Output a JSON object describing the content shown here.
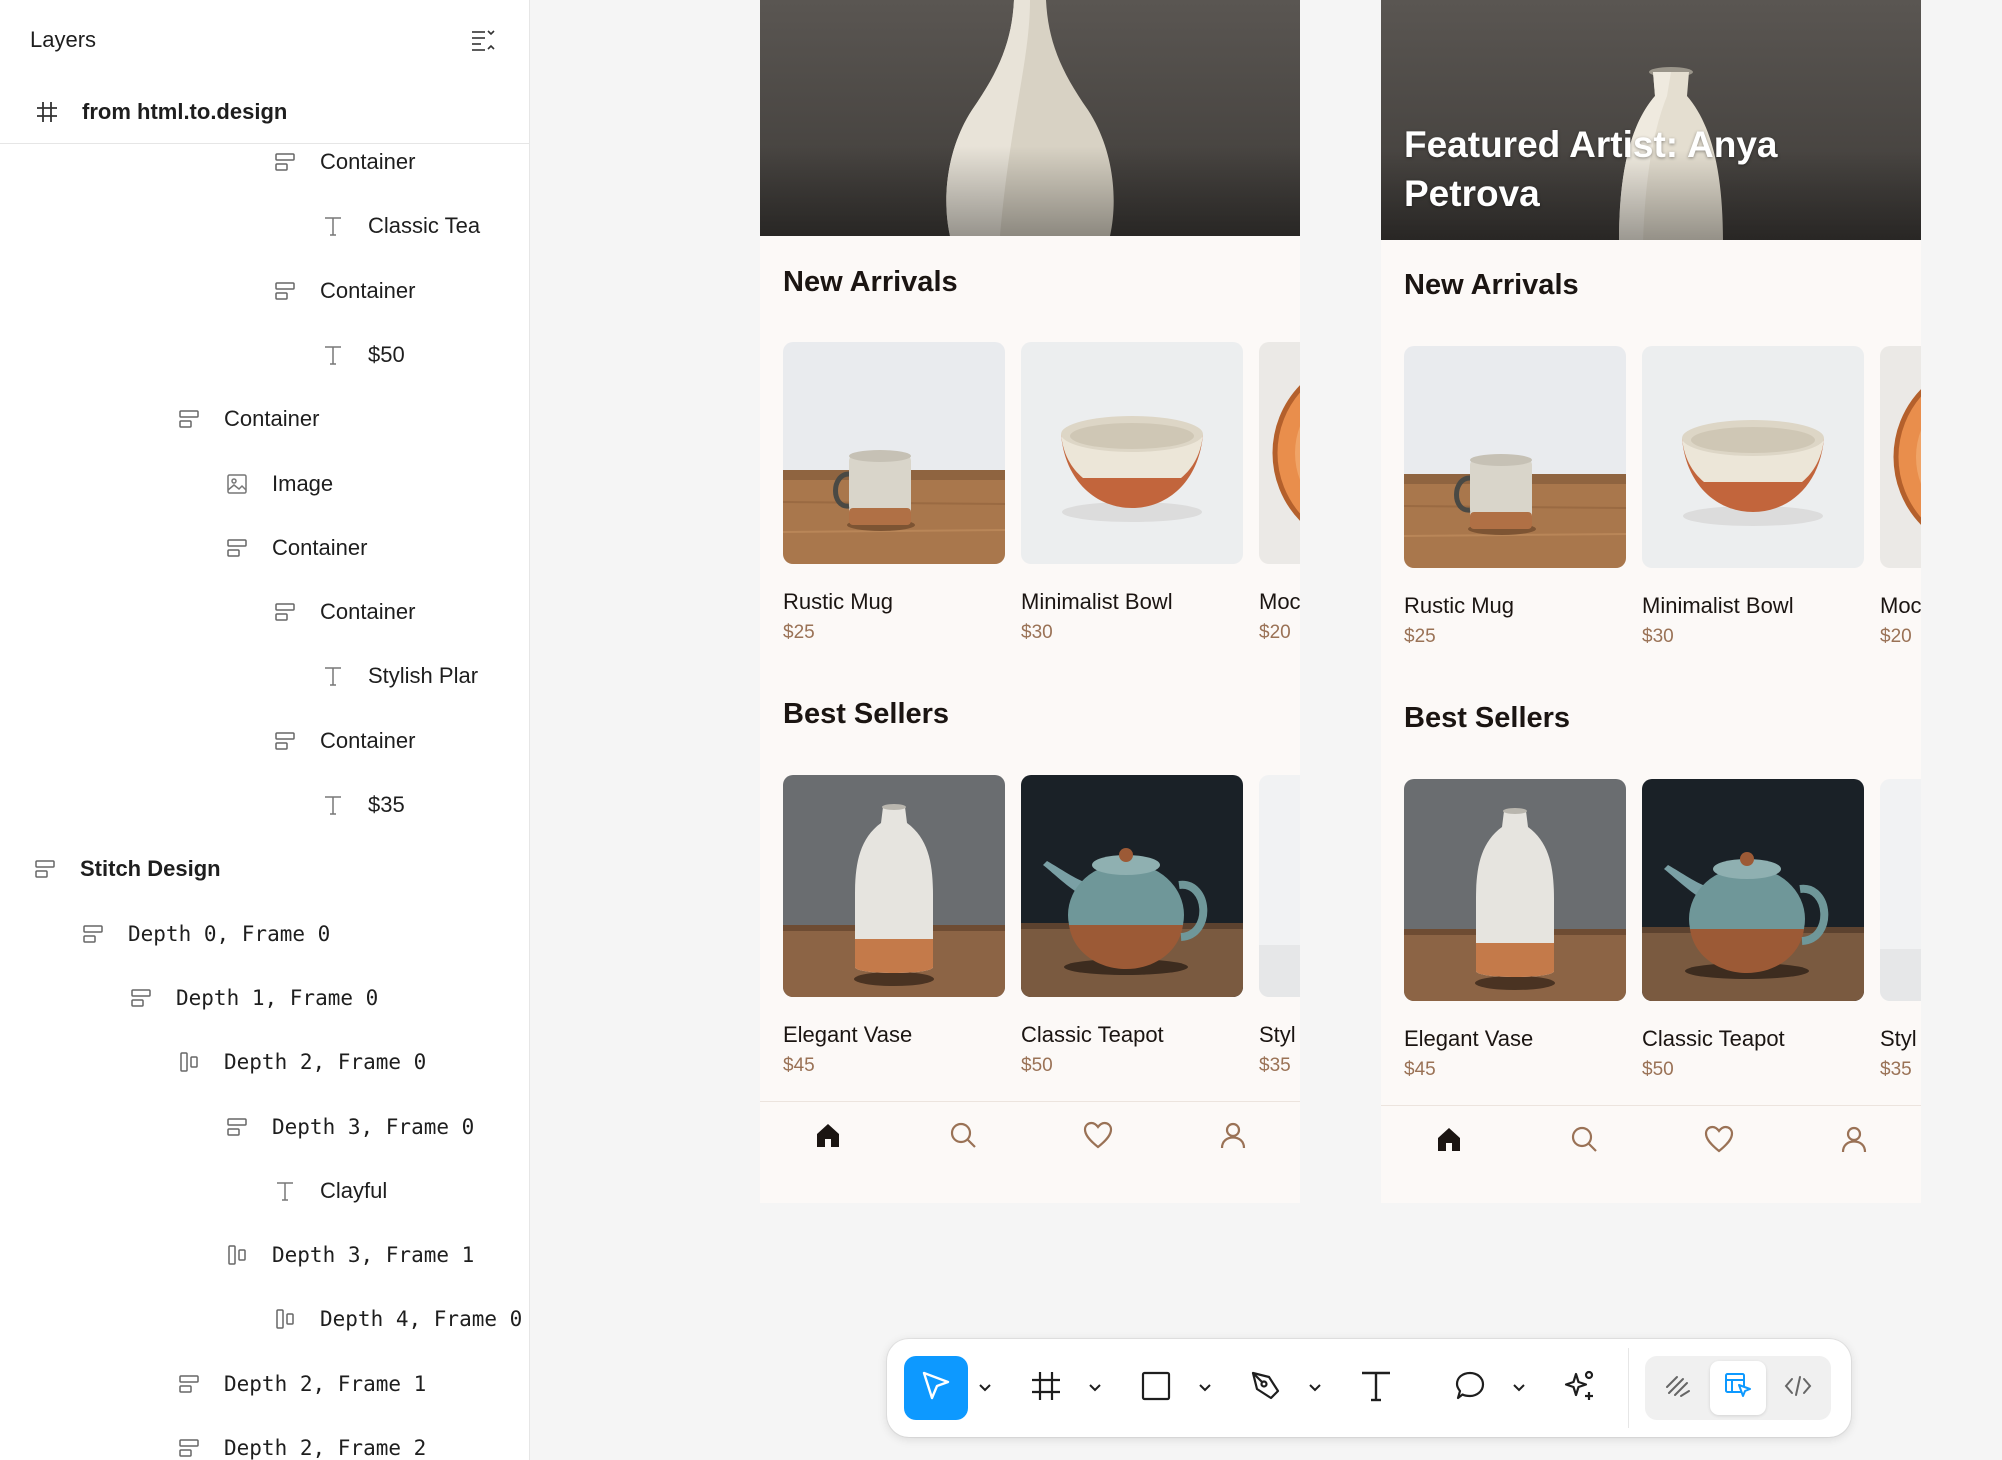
{
  "layers_panel": {
    "title": "Layers",
    "root_frame": "from html.to.design",
    "rows": [
      {
        "label": "Container",
        "icon": "auto-layout-vertical-icon",
        "indent": 5,
        "bold": false,
        "mono": false
      },
      {
        "label": "Classic Tea",
        "icon": "text-icon",
        "indent": 6,
        "bold": false,
        "mono": false
      },
      {
        "label": "Container",
        "icon": "auto-layout-vertical-icon",
        "indent": 5,
        "bold": false,
        "mono": false
      },
      {
        "label": "$50",
        "icon": "text-icon",
        "indent": 6,
        "bold": false,
        "mono": false
      },
      {
        "label": "Container",
        "icon": "auto-layout-vertical-icon",
        "indent": 3,
        "bold": false,
        "mono": false
      },
      {
        "label": "Image",
        "icon": "image-icon",
        "indent": 4,
        "bold": false,
        "mono": false
      },
      {
        "label": "Container",
        "icon": "auto-layout-vertical-icon",
        "indent": 4,
        "bold": false,
        "mono": false
      },
      {
        "label": "Container",
        "icon": "auto-layout-vertical-icon",
        "indent": 5,
        "bold": false,
        "mono": false
      },
      {
        "label": "Stylish Plar",
        "icon": "text-icon",
        "indent": 6,
        "bold": false,
        "mono": false
      },
      {
        "label": "Container",
        "icon": "auto-layout-vertical-icon",
        "indent": 5,
        "bold": false,
        "mono": false
      },
      {
        "label": "$35",
        "icon": "text-icon",
        "indent": 6,
        "bold": false,
        "mono": false
      },
      {
        "label": "Stitch Design",
        "icon": "auto-layout-vertical-icon",
        "indent": 0,
        "bold": true,
        "mono": false
      },
      {
        "label": "Depth 0, Frame 0",
        "icon": "auto-layout-vertical-icon",
        "indent": 1,
        "bold": false,
        "mono": true
      },
      {
        "label": "Depth 1, Frame 0",
        "icon": "auto-layout-vertical-icon",
        "indent": 2,
        "bold": false,
        "mono": true
      },
      {
        "label": "Depth 2, Frame 0",
        "icon": "auto-layout-horizontal-icon",
        "indent": 3,
        "bold": false,
        "mono": true
      },
      {
        "label": "Depth 3, Frame 0",
        "icon": "auto-layout-vertical-icon",
        "indent": 4,
        "bold": false,
        "mono": true
      },
      {
        "label": "Clayful",
        "icon": "text-icon",
        "indent": 5,
        "bold": false,
        "mono": false
      },
      {
        "label": "Depth 3, Frame 1",
        "icon": "auto-layout-horizontal-icon",
        "indent": 4,
        "bold": false,
        "mono": true
      },
      {
        "label": "Depth 4, Frame 0",
        "icon": "auto-layout-horizontal-icon",
        "indent": 5,
        "bold": false,
        "mono": true
      },
      {
        "label": "Depth 2, Frame 1",
        "icon": "auto-layout-vertical-icon",
        "indent": 3,
        "bold": false,
        "mono": true
      },
      {
        "label": "Depth 2, Frame 2",
        "icon": "auto-layout-vertical-icon",
        "indent": 3,
        "bold": false,
        "mono": true
      }
    ]
  },
  "frames": [
    {
      "hero_title": "",
      "new_arrivals_heading": "New Arrivals",
      "best_sellers_heading": "Best Sellers",
      "new_arrivals": [
        {
          "name": "Rustic Mug",
          "price": "$25",
          "image": "mug"
        },
        {
          "name": "Minimalist Bowl",
          "price": "$30",
          "image": "bowl"
        },
        {
          "name": "Moc",
          "price": "$20",
          "image": "plate"
        }
      ],
      "best_sellers": [
        {
          "name": "Elegant Vase",
          "price": "$45",
          "image": "vase"
        },
        {
          "name": "Classic Teapot",
          "price": "$50",
          "image": "teapot"
        },
        {
          "name": "Styl",
          "price": "$35",
          "image": "light"
        }
      ],
      "nav_icons": [
        "home-icon",
        "search-icon",
        "heart-icon",
        "user-icon"
      ]
    },
    {
      "hero_title": "Featured Artist: Anya Petrova",
      "new_arrivals_heading": "New Arrivals",
      "best_sellers_heading": "Best Sellers",
      "new_arrivals": [
        {
          "name": "Rustic Mug",
          "price": "$25",
          "image": "mug"
        },
        {
          "name": "Minimalist Bowl",
          "price": "$30",
          "image": "bowl"
        },
        {
          "name": "Moc",
          "price": "$20",
          "image": "plate"
        }
      ],
      "best_sellers": [
        {
          "name": "Elegant Vase",
          "price": "$45",
          "image": "vase"
        },
        {
          "name": "Classic Teapot",
          "price": "$50",
          "image": "teapot"
        },
        {
          "name": "Styl",
          "price": "$35",
          "image": "light"
        }
      ],
      "nav_icons": [
        "home-icon",
        "search-icon",
        "heart-icon",
        "user-icon"
      ]
    }
  ],
  "toolbar": {
    "tools": [
      {
        "name": "move-tool",
        "icon": "cursor-icon",
        "active": true,
        "has_menu": true
      },
      {
        "name": "frame-tool",
        "icon": "frame-icon",
        "active": false,
        "has_menu": true
      },
      {
        "name": "rectangle-tool",
        "icon": "rectangle-icon",
        "active": false,
        "has_menu": true
      },
      {
        "name": "pen-tool",
        "icon": "pen-icon",
        "active": false,
        "has_menu": true
      },
      {
        "name": "text-tool",
        "icon": "text-icon",
        "active": false,
        "has_menu": false
      },
      {
        "name": "comment-tool",
        "icon": "comment-icon",
        "active": false,
        "has_menu": true
      },
      {
        "name": "actions-tool",
        "icon": "ai-sparkle-icon",
        "active": false,
        "has_menu": false
      }
    ],
    "modes": [
      {
        "name": "draw-mode",
        "icon": "draw-icon",
        "selected": false
      },
      {
        "name": "design-mode",
        "icon": "design-icon",
        "selected": true
      },
      {
        "name": "dev-mode",
        "icon": "code-icon",
        "selected": false
      }
    ]
  },
  "colors": {
    "accent": "#0d99ff",
    "frame_background": "#fcf9f7",
    "price_text": "#9a7256",
    "heading_text": "#1b1512"
  }
}
